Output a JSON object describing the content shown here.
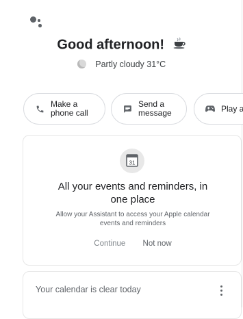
{
  "header": {
    "greeting": "Good afternoon!",
    "weather_text": "Partly cloudy 31°C"
  },
  "chips": [
    {
      "label_line1": "Make a",
      "label_line2": "phone call",
      "icon": "phone-icon"
    },
    {
      "label_line1": "Send a",
      "label_line2": "message",
      "icon": "message-icon"
    },
    {
      "label": "Play a",
      "icon": "gamepad-icon"
    }
  ],
  "calendar_card": {
    "icon_day": "31",
    "title_line1": "All your events and reminders, in",
    "title_line2": "one place",
    "subtitle_line1": "Allow your Assistant to access your Apple calendar",
    "subtitle_line2": "events and reminders",
    "continue_label": "Continue",
    "not_now_label": "Not now"
  },
  "agenda_card": {
    "text": "Your calendar is clear today"
  },
  "colors": {
    "text": "#202124",
    "secondary": "#5f6368",
    "border": "#dadce0"
  }
}
